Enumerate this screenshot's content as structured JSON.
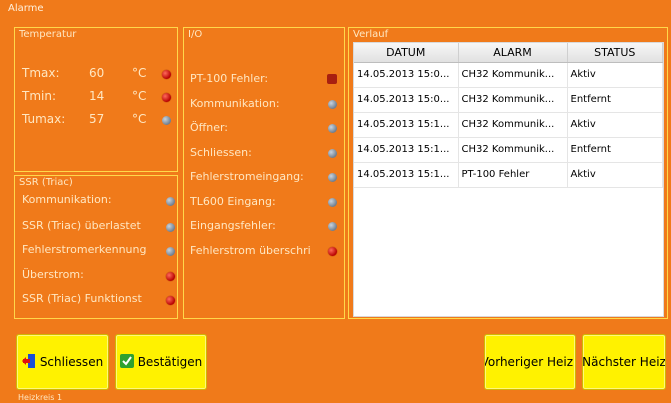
{
  "window": {
    "title": "Alarme"
  },
  "temperature": {
    "title": "Temperatur",
    "rows": [
      {
        "label": "Tmax:",
        "value": "60",
        "unit": "°C",
        "led": "red"
      },
      {
        "label": "Tmin:",
        "value": "14",
        "unit": "°C",
        "led": "red"
      },
      {
        "label": "Tumax:",
        "value": "57",
        "unit": "°C",
        "led": "grey"
      }
    ]
  },
  "ssr": {
    "title": "SSR (Triac)",
    "items": [
      {
        "label": "Kommunikation:",
        "led": "grey"
      },
      {
        "label": "SSR (Triac) überlastet",
        "led": "grey"
      },
      {
        "label": "Fehlerstromerkennung",
        "led": "grey"
      },
      {
        "label": "Überstrom:",
        "led": "red"
      },
      {
        "label": "SSR (Triac) Funktionst",
        "led": "red"
      }
    ]
  },
  "io": {
    "title": "I/O",
    "items": [
      {
        "label": "PT-100 Fehler:",
        "led": "square"
      },
      {
        "label": "Kommunikation:",
        "led": "grey"
      },
      {
        "label": "Öffner:",
        "led": "grey"
      },
      {
        "label": "Schliessen:",
        "led": "grey"
      },
      {
        "label": "Fehlerstromeingang:",
        "led": "grey"
      },
      {
        "label": "TL600 Eingang:",
        "led": "grey"
      },
      {
        "label": "Eingangsfehler:",
        "led": "grey"
      },
      {
        "label": "Fehlerstrom überschri",
        "led": "red"
      }
    ]
  },
  "history": {
    "title": "Verlauf",
    "columns": [
      "DATUM",
      "ALARM",
      "STATUS"
    ],
    "rows": [
      [
        "14.05.2013 15:0...",
        "CH32 Kommunik...",
        "Aktiv"
      ],
      [
        "14.05.2013 15:0...",
        "CH32 Kommunik...",
        "Entfernt"
      ],
      [
        "14.05.2013 15:1...",
        "CH32 Kommunik...",
        "Aktiv"
      ],
      [
        "14.05.2013 15:1...",
        "CH32 Kommunik...",
        "Entfernt"
      ],
      [
        "14.05.2013 15:1...",
        "PT-100 Fehler",
        "Aktiv"
      ]
    ]
  },
  "buttons": {
    "close": "Schliessen",
    "confirm": "Bestätigen",
    "prev": "Vorheriger Heiz",
    "next": "Nächster Heiz"
  },
  "footer": {
    "text": "Heizkreis 1"
  },
  "colors": {
    "background": "#f07a1a",
    "border": "#ffd84a",
    "button": "#fff200",
    "led_red": "#c00000",
    "led_grey": "#8090a0"
  }
}
